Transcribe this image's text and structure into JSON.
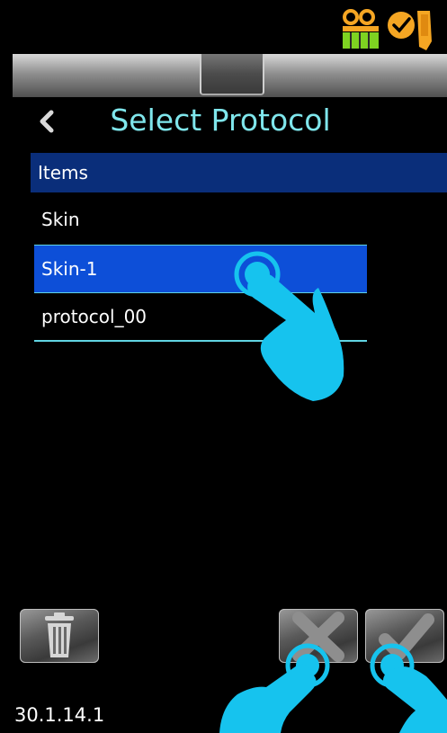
{
  "header": {
    "title": "Select Protocol"
  },
  "list": {
    "header": "Items",
    "items": [
      {
        "label": "Skin"
      },
      {
        "label": "Skin-1"
      },
      {
        "label": "protocol_00"
      }
    ]
  },
  "footer": {
    "version": "30.1.14.1"
  },
  "icons": {
    "back": "chevron-left-icon",
    "battery": "battery-icon",
    "probe": "probe-icon",
    "delete": "trash-icon",
    "cancel": "close-icon",
    "confirm": "check-icon",
    "gesture": "tap-hand-icon"
  },
  "colors": {
    "title": "#7fe6ec",
    "list_header_bg": "#0a2e7a",
    "selected_row_bg": "#0d4fd8",
    "divider": "#61d4e3",
    "hand": "#16c3ee"
  }
}
